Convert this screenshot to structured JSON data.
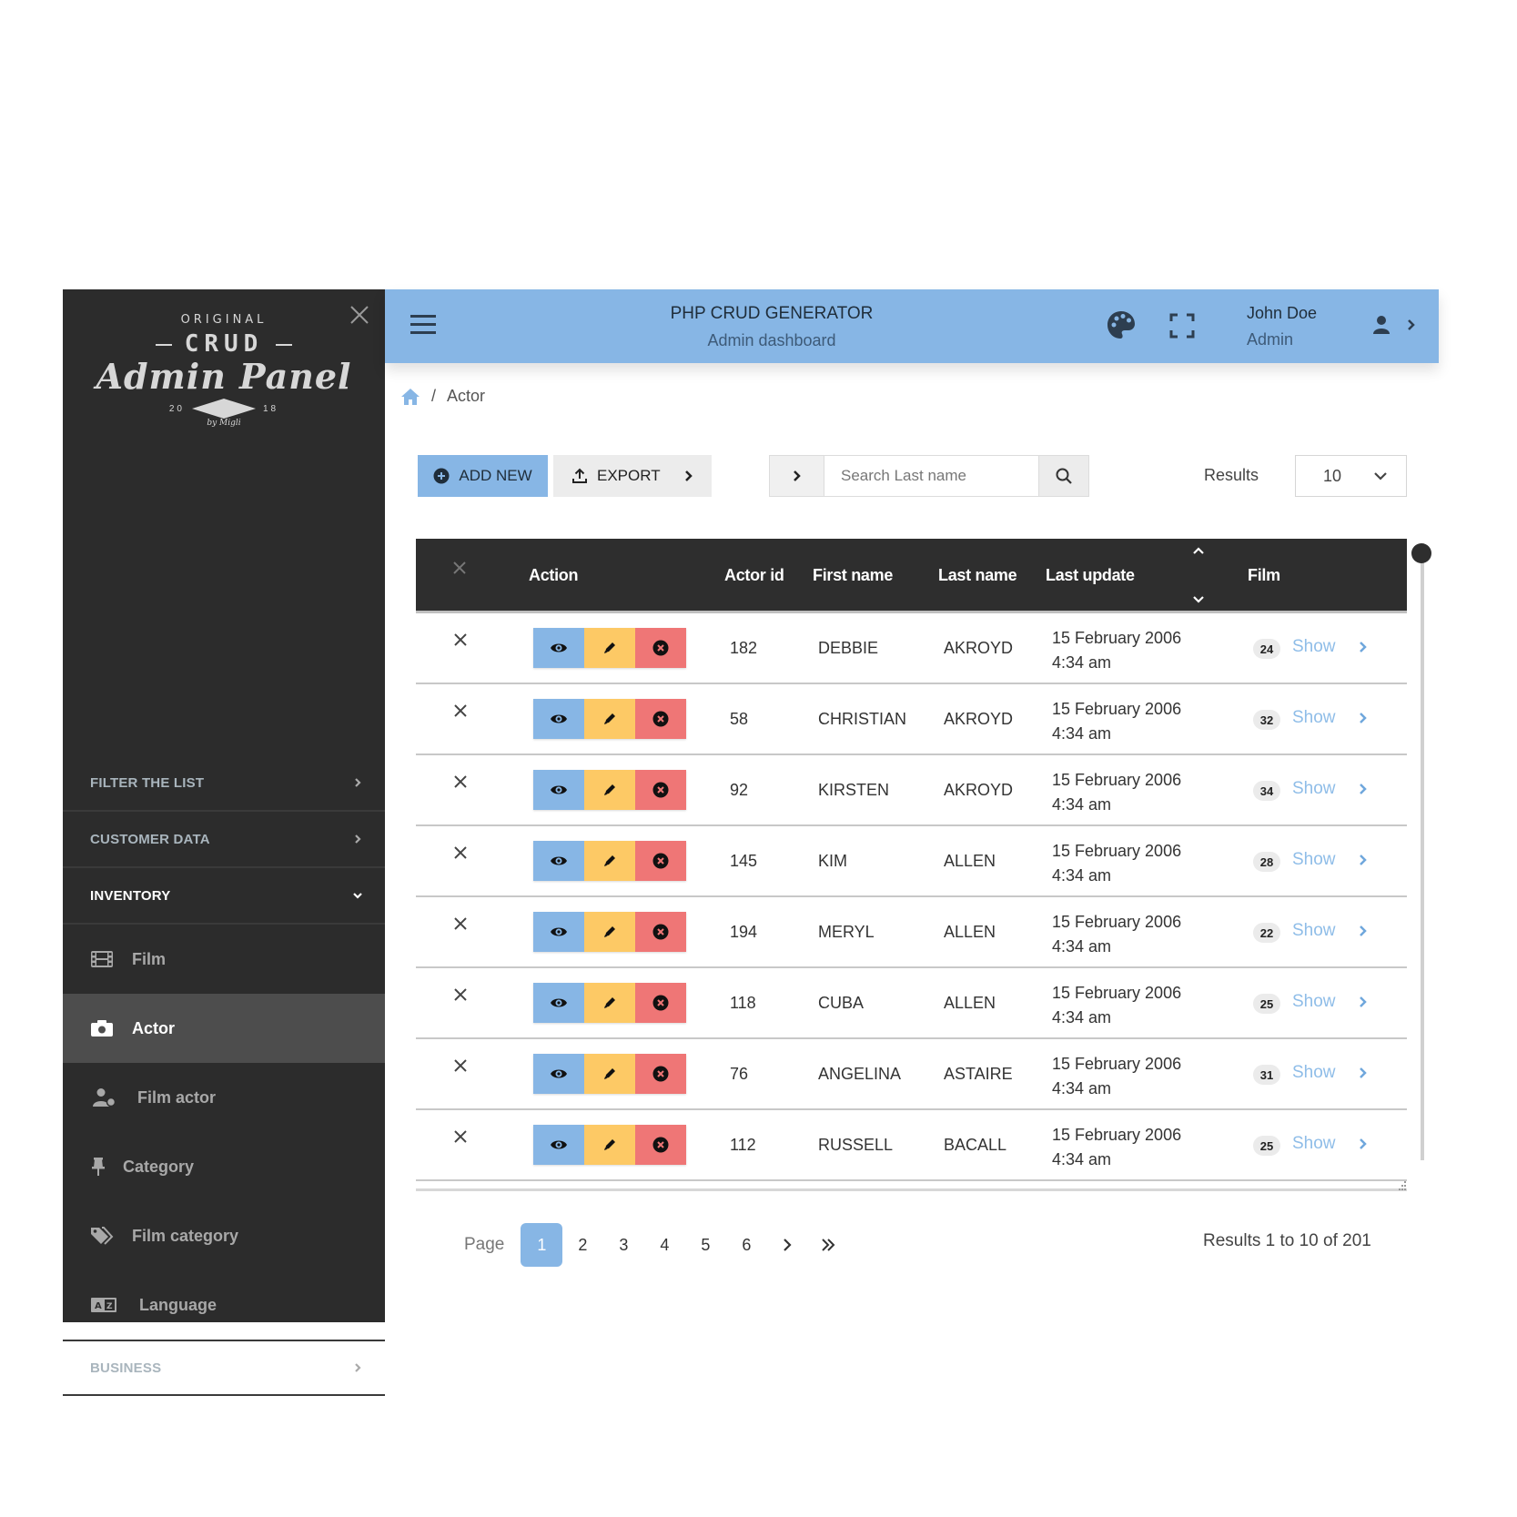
{
  "sidebar": {
    "logo": {
      "line1": "ORIGINAL",
      "line2": "CRUD",
      "line3": "Admin Panel",
      "year_left": "20",
      "year_right": "18",
      "byline": "by Migli"
    },
    "sections": [
      {
        "label": "FILTER THE LIST",
        "state": "collapsed"
      },
      {
        "label": "CUSTOMER DATA",
        "state": "collapsed"
      },
      {
        "label": "INVENTORY",
        "state": "expanded"
      }
    ],
    "inventory_items": [
      {
        "label": "Film",
        "icon": "film-icon"
      },
      {
        "label": "Actor",
        "icon": "camera-icon",
        "active": true
      },
      {
        "label": "Film actor",
        "icon": "user-tag-icon"
      },
      {
        "label": "Category",
        "icon": "thumbtack-icon"
      },
      {
        "label": "Film category",
        "icon": "tags-icon"
      },
      {
        "label": "Language",
        "icon": "language-icon"
      }
    ],
    "bottom_sections": [
      {
        "label": "BUSINESS",
        "state": "collapsed"
      }
    ]
  },
  "header": {
    "title": "PHP CRUD GENERATOR",
    "subtitle": "Admin dashboard",
    "user_name": "John Doe",
    "user_role": "Admin"
  },
  "breadcrumb": {
    "separator": "/",
    "current": "Actor"
  },
  "toolbar": {
    "add_label": "ADD NEW",
    "export_label": "EXPORT",
    "search_placeholder": "Search Last name",
    "search_value": "",
    "results_label": "Results",
    "results_per_page": "10"
  },
  "table": {
    "columns": [
      "Action",
      "Actor id",
      "First name",
      "Last name",
      "Last update",
      "Film"
    ],
    "show_label": "Show",
    "rows": [
      {
        "actor_id": "182",
        "first_name": "DEBBIE",
        "last_name": "AKROYD",
        "date": "15 February 2006",
        "time": "4:34 am",
        "film_count": "24"
      },
      {
        "actor_id": "58",
        "first_name": "CHRISTIAN",
        "last_name": "AKROYD",
        "date": "15 February 2006",
        "time": "4:34 am",
        "film_count": "32"
      },
      {
        "actor_id": "92",
        "first_name": "KIRSTEN",
        "last_name": "AKROYD",
        "date": "15 February 2006",
        "time": "4:34 am",
        "film_count": "34"
      },
      {
        "actor_id": "145",
        "first_name": "KIM",
        "last_name": "ALLEN",
        "date": "15 February 2006",
        "time": "4:34 am",
        "film_count": "28"
      },
      {
        "actor_id": "194",
        "first_name": "MERYL",
        "last_name": "ALLEN",
        "date": "15 February 2006",
        "time": "4:34 am",
        "film_count": "22"
      },
      {
        "actor_id": "118",
        "first_name": "CUBA",
        "last_name": "ALLEN",
        "date": "15 February 2006",
        "time": "4:34 am",
        "film_count": "25"
      },
      {
        "actor_id": "76",
        "first_name": "ANGELINA",
        "last_name": "ASTAIRE",
        "date": "15 February 2006",
        "time": "4:34 am",
        "film_count": "31"
      },
      {
        "actor_id": "112",
        "first_name": "RUSSELL",
        "last_name": "BACALL",
        "date": "15 February 2006",
        "time": "4:34 am",
        "film_count": "25"
      }
    ]
  },
  "pagination": {
    "label": "Page",
    "pages": [
      "1",
      "2",
      "3",
      "4",
      "5",
      "6"
    ],
    "current": "1",
    "summary": "Results 1 to 10 of 201"
  },
  "colors": {
    "primary": "#87b6e5",
    "warning": "#fdc965",
    "danger": "#ef7676",
    "sidebar_bg": "#2c2c2c",
    "table_header_bg": "#2e2e2e"
  }
}
